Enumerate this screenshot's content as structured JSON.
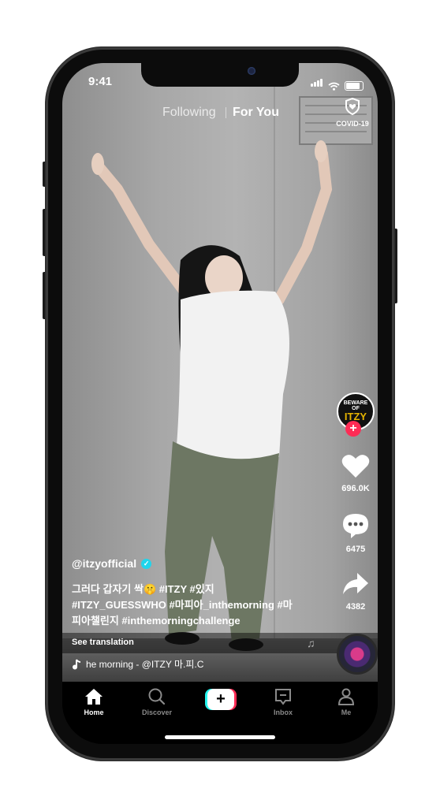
{
  "status_bar": {
    "time": "9:41"
  },
  "top_nav": {
    "following": "Following",
    "for_you": "For You",
    "covid_label": "COVID-19"
  },
  "creator_avatar": {
    "line1": "BEWARE",
    "line2": "OF",
    "line3": "ITZY"
  },
  "actions": {
    "likes": "696.0K",
    "comments": "6475",
    "shares": "4382"
  },
  "post": {
    "username": "@itzyofficial",
    "caption_line1": "그러다 갑자기 싹🤫 #ITZY #있지",
    "caption_line2": "#ITZY_GUESSWHO #마피아_inthemorning #마",
    "caption_line3": "피아챌린지 #inthemorningchallenge",
    "see_translation": "See translation",
    "music": "he morning - @ITZY   마.피.C"
  },
  "tab_bar": {
    "home": "Home",
    "discover": "Discover",
    "create": "+",
    "inbox": "Inbox",
    "me": "Me"
  },
  "colors": {
    "accent_red": "#fe2c55",
    "accent_cyan": "#25f4ee",
    "verified": "#20d5ec"
  }
}
